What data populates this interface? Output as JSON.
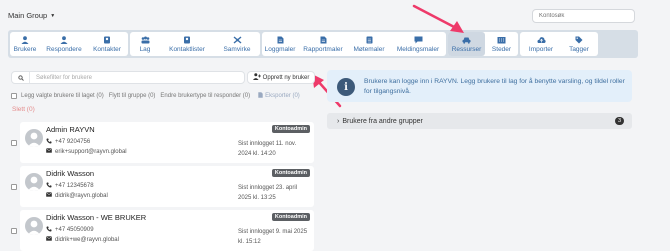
{
  "header": {
    "group_select": "Main Group",
    "search_placeholder": "Kontosøk"
  },
  "nav": {
    "items": [
      {
        "label": "Brukere",
        "icon": "user-icon"
      },
      {
        "label": "Respondere",
        "icon": "person-icon"
      },
      {
        "label": "Kontakter",
        "icon": "contact-card-icon"
      },
      {
        "label": "Lag",
        "icon": "team-icon"
      },
      {
        "label": "Kontaktlister",
        "icon": "contact-list-icon"
      },
      {
        "label": "Samvirke",
        "icon": "cooperation-icon"
      },
      {
        "label": "Loggmaler",
        "icon": "log-template-icon"
      },
      {
        "label": "Rapportmaler",
        "icon": "report-template-icon"
      },
      {
        "label": "Møtemaler",
        "icon": "meeting-template-icon"
      },
      {
        "label": "Meldingsmaler",
        "icon": "message-template-icon"
      },
      {
        "label": "Ressurser",
        "icon": "vehicle-icon",
        "active": true
      },
      {
        "label": "Steder",
        "icon": "building-icon"
      },
      {
        "label": "Importer",
        "icon": "cloud-upload-icon"
      },
      {
        "label": "Tagger",
        "icon": "tags-icon"
      }
    ]
  },
  "users_panel": {
    "search_placeholder": "Søkefilter for brukere",
    "create_button": "Opprett ny bruker",
    "actions": {
      "add_selected": "Legg valgte brukere til laget (0)",
      "move_to_group": "Flytt til gruppe (0)",
      "change_type": "Endre brukertype til responder (0)",
      "export": "Eksporter (0)"
    },
    "delete": "Slett (0)",
    "users": [
      {
        "name": "Admin RAYVN",
        "phone": "+47 9204756",
        "email": "erik+support@rayvn.global",
        "badge": "Kontoadmin",
        "last_login": "Sist innlogget 11. nov. 2024 kl. 14:20"
      },
      {
        "name": "Didrik Wasson",
        "phone": "+47 12345678",
        "email": "didrik@rayvn.global",
        "badge": "Kontoadmin",
        "last_login": "Sist innlogget 23. april 2025 kl. 13:25"
      },
      {
        "name": "Didrik Wasson - WE BRUKER",
        "phone": "+47 45050909",
        "email": "didrik+we@rayvn.global",
        "badge": "Kontoadmin",
        "last_login": "Sist innlogget 9. mai 2025 kl. 15:12"
      }
    ]
  },
  "info": {
    "text": "Brukere kan logge inn i RAYVN. Legg brukere til lag for å benytte varsling, og tildel roller for tilgangsnivå."
  },
  "other_groups": {
    "label": "Brukere fra andre grupper",
    "count": "3"
  },
  "colors": {
    "nav_bar": "#d6dee6",
    "nav_text": "#3a6ea8",
    "arrow": "#ee3a6a",
    "info_bg": "#e3effa",
    "info_text": "#3f6f9f",
    "delete_text": "#e48b8b",
    "badge_bg": "#5c5f63"
  }
}
